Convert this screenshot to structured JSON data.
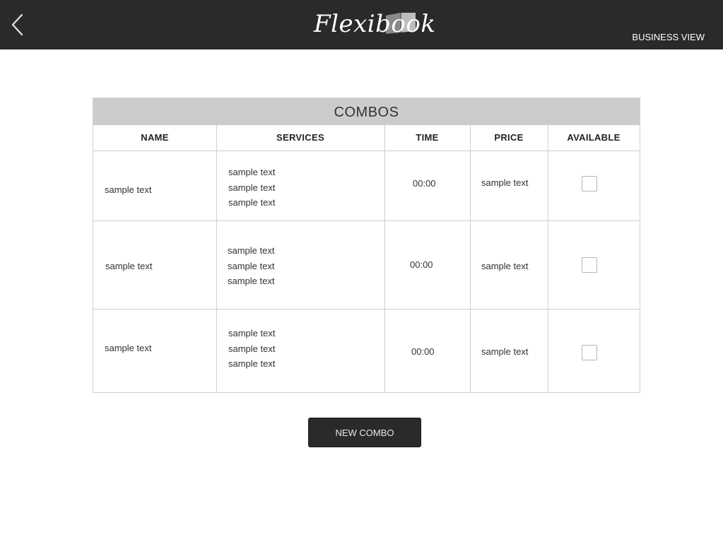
{
  "header": {
    "app_name": "Flexibook",
    "business_view_label": "BUSINESS VIEW"
  },
  "table": {
    "title": "COMBOS",
    "columns": [
      "NAME",
      "SERVICES",
      "TIME",
      "PRICE",
      "AVAILABLE"
    ],
    "rows": [
      {
        "name": "sample text",
        "services": [
          "sample text",
          "sample text",
          "sample text"
        ],
        "time": "00:00",
        "price": "sample text",
        "available": false
      },
      {
        "name": "sample text",
        "services": [
          "sample text",
          "sample text",
          "sample text"
        ],
        "time": "00:00",
        "price": "sample text",
        "available": false
      },
      {
        "name": "sample text",
        "services": [
          "sample text",
          "sample text",
          "sample text"
        ],
        "time": "00:00",
        "price": "sample text",
        "available": false
      }
    ]
  },
  "actions": {
    "new_combo_label": "NEW COMBO"
  },
  "colors": {
    "header_bg": "#2a2a2a",
    "title_bar_bg": "#cccccc",
    "button_bg": "#2a2a2a"
  }
}
